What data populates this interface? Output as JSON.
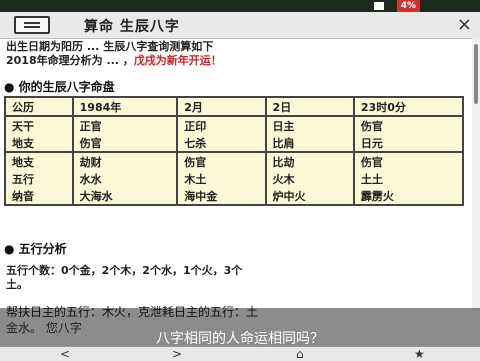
{
  "status": {
    "battery": "4%"
  },
  "header": {
    "title": "算命 生辰八字",
    "menu_icon": "menu-icon",
    "close_glyph": "×"
  },
  "intro": {
    "line1": "出生日期为阳历 ... 生辰八字查询测算如下",
    "line2_prefix": "2018年命理分析为 ... ，",
    "line2_highlight": "戊戌为新年开运！"
  },
  "section1": "● 你的生辰八字命盘",
  "table": {
    "rows": [
      [
        "公历",
        "1984年",
        "2月",
        "2日",
        "23时0分"
      ],
      [
        "天干",
        "正官",
        "正印",
        "日主",
        "伤官"
      ],
      [
        "地支",
        "伤官",
        "七杀",
        "比肩",
        "日元"
      ],
      [
        "地支",
        "劫财",
        "伤官",
        "比劫",
        "伤官"
      ],
      [
        "五行",
        "水水",
        "木土",
        "火木",
        "土土"
      ],
      [
        "纳音",
        "大海水",
        "海中金",
        "炉中火",
        "霹雳火"
      ]
    ]
  },
  "section2": "● 五行分析",
  "wuxing_line1": "五行个数：0个金，2个木，2个水，1个火，3个",
  "wuxing_line2": "土。",
  "wuxing_detail1": "帮扶日主的五行：木火，克泄耗日主的五行：土",
  "wuxing_detail2": "金水。 您八字",
  "subtitle": "八字相同的人命运相同吗？",
  "nav": {
    "back": "<",
    "forward": ">",
    "home": "⌂",
    "star": "★"
  }
}
